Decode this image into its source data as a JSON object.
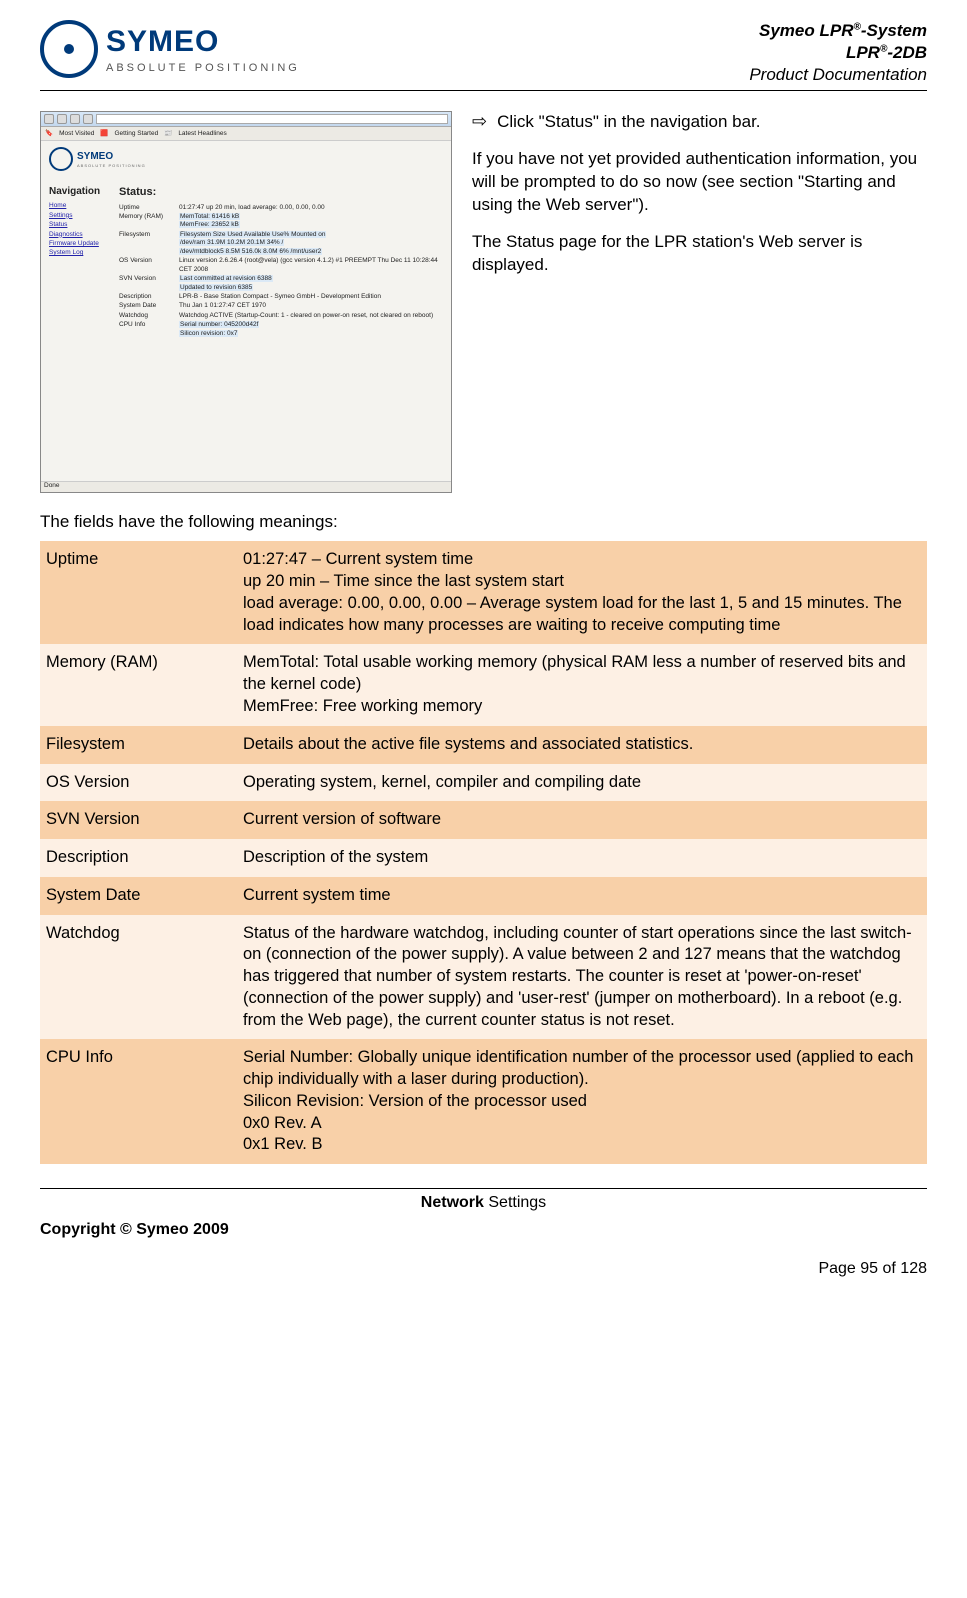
{
  "header": {
    "logo_main": "SYMEO",
    "logo_sub": "ABSOLUTE POSITIONING",
    "title_line1a": "Symeo LPR",
    "title_line1b": "-System",
    "title_line2a": "LPR",
    "title_line2b": "-2DB",
    "title_line3": "Product Documentation"
  },
  "instruction": {
    "click_status": "Click \"Status\" in the navigation bar.",
    "para1": "If you have not yet provided authentication information, you will be prompted to do so now (see section \"Starting and using the Web server\").",
    "para2": "The Status page for the LPR station's Web server is displayed."
  },
  "screenshot": {
    "bookmarks": {
      "a": "Most Visited",
      "b": "Getting Started",
      "c": "Latest Headlines"
    },
    "logo_main": "SYMEO",
    "logo_sub": "ABSOLUTE POSITIONING",
    "nav_header": "Navigation",
    "status_header": "Status:",
    "nav": {
      "home": "Home",
      "settings": "Settings",
      "status": "Status",
      "diagnostics": "Diagnostics",
      "firmware": "Firmware Update",
      "syslog": "System Log"
    },
    "rows": {
      "uptime_lbl": "Uptime",
      "uptime_val": "01:27:47 up 20 min, load average: 0.00, 0.00, 0.00",
      "mem_lbl": "Memory (RAM)",
      "mem_total": "MemTotal: 61416 kB",
      "mem_free": "MemFree: 23652 kB",
      "fs_lbl": "Filesystem",
      "fs_hdr": "Filesystem      Size   Used   Available Use% Mounted on",
      "fs_l1": "/dev/ram       31.9M  10.2M  20.1M   34%  /",
      "fs_l2": "/dev/mtdblock5 8.5M   516.0k 8.0M    6%  /mnt/user2",
      "os_lbl": "OS Version",
      "os_val": "Linux version 2.6.26.4 (root@vela) (gcc version 4.1.2) #1 PREEMPT Thu Dec 11 10:28:44 CET 2008",
      "svn_lbl": "SVN Version",
      "svn_l1": "Last committed at revision 6388",
      "svn_l2": "Updated to revision 6385",
      "desc_lbl": "Description",
      "desc_val": "LPR-B - Base Station Compact - Symeo GmbH - Development Edition",
      "date_lbl": "System Date",
      "date_val": "Thu Jan 1 01:27:47 CET 1970",
      "wd_lbl": "Watchdog",
      "wd_val": "Watchdog ACTIVE (Startup-Count: 1 - cleared on power-on reset, not cleared on reboot)",
      "cpu_lbl": "CPU Info",
      "cpu_l1": "Serial number:   045200d42f",
      "cpu_l2": "Silicon revision: 0x7"
    },
    "done": "Done"
  },
  "intro": "The fields have the following meanings:",
  "fields": [
    {
      "label": "Uptime",
      "desc": "01:27:47 – Current system time\nup 20 min – Time since the last system start\nload average: 0.00, 0.00, 0.00 – Average system load for the last 1, 5 and 15 minutes. The load indicates how many processes are waiting to receive computing time"
    },
    {
      "label": "Memory (RAM)",
      "desc": "MemTotal: Total usable working memory (physical RAM less a number of reserved bits and the kernel code)\nMemFree: Free working memory"
    },
    {
      "label": "Filesystem",
      "desc": "Details about the active file systems and associated statistics."
    },
    {
      "label": "OS Version",
      "desc": "Operating system, kernel, compiler and compiling date"
    },
    {
      "label": "SVN Version",
      "desc": "Current version of software"
    },
    {
      "label": "Description",
      "desc": "Description of the system"
    },
    {
      "label": "System Date",
      "desc": "Current system time"
    },
    {
      "label": "Watchdog",
      "desc": "Status of the hardware watchdog, including counter of start operations since the last switch-on (connection of the power supply). A value between 2 and 127 means that the watchdog has triggered that number of system restarts. The counter is reset at 'power-on-reset' (connection of the power supply) and 'user-rest' (jumper on motherboard). In a reboot (e.g. from the Web page), the current counter status is not reset."
    },
    {
      "label": "CPU Info",
      "desc": "Serial Number: Globally unique identification number of the processor used (applied to each chip individually with a laser during production).\nSilicon Revision: Version of the processor used\n0x0 Rev. A\n0x1 Rev. B"
    }
  ],
  "footer": {
    "section_bold": "Network",
    "section_rest": " Settings",
    "copyright": "Copyright © Symeo 2009",
    "page": "Page 95 of 128"
  }
}
